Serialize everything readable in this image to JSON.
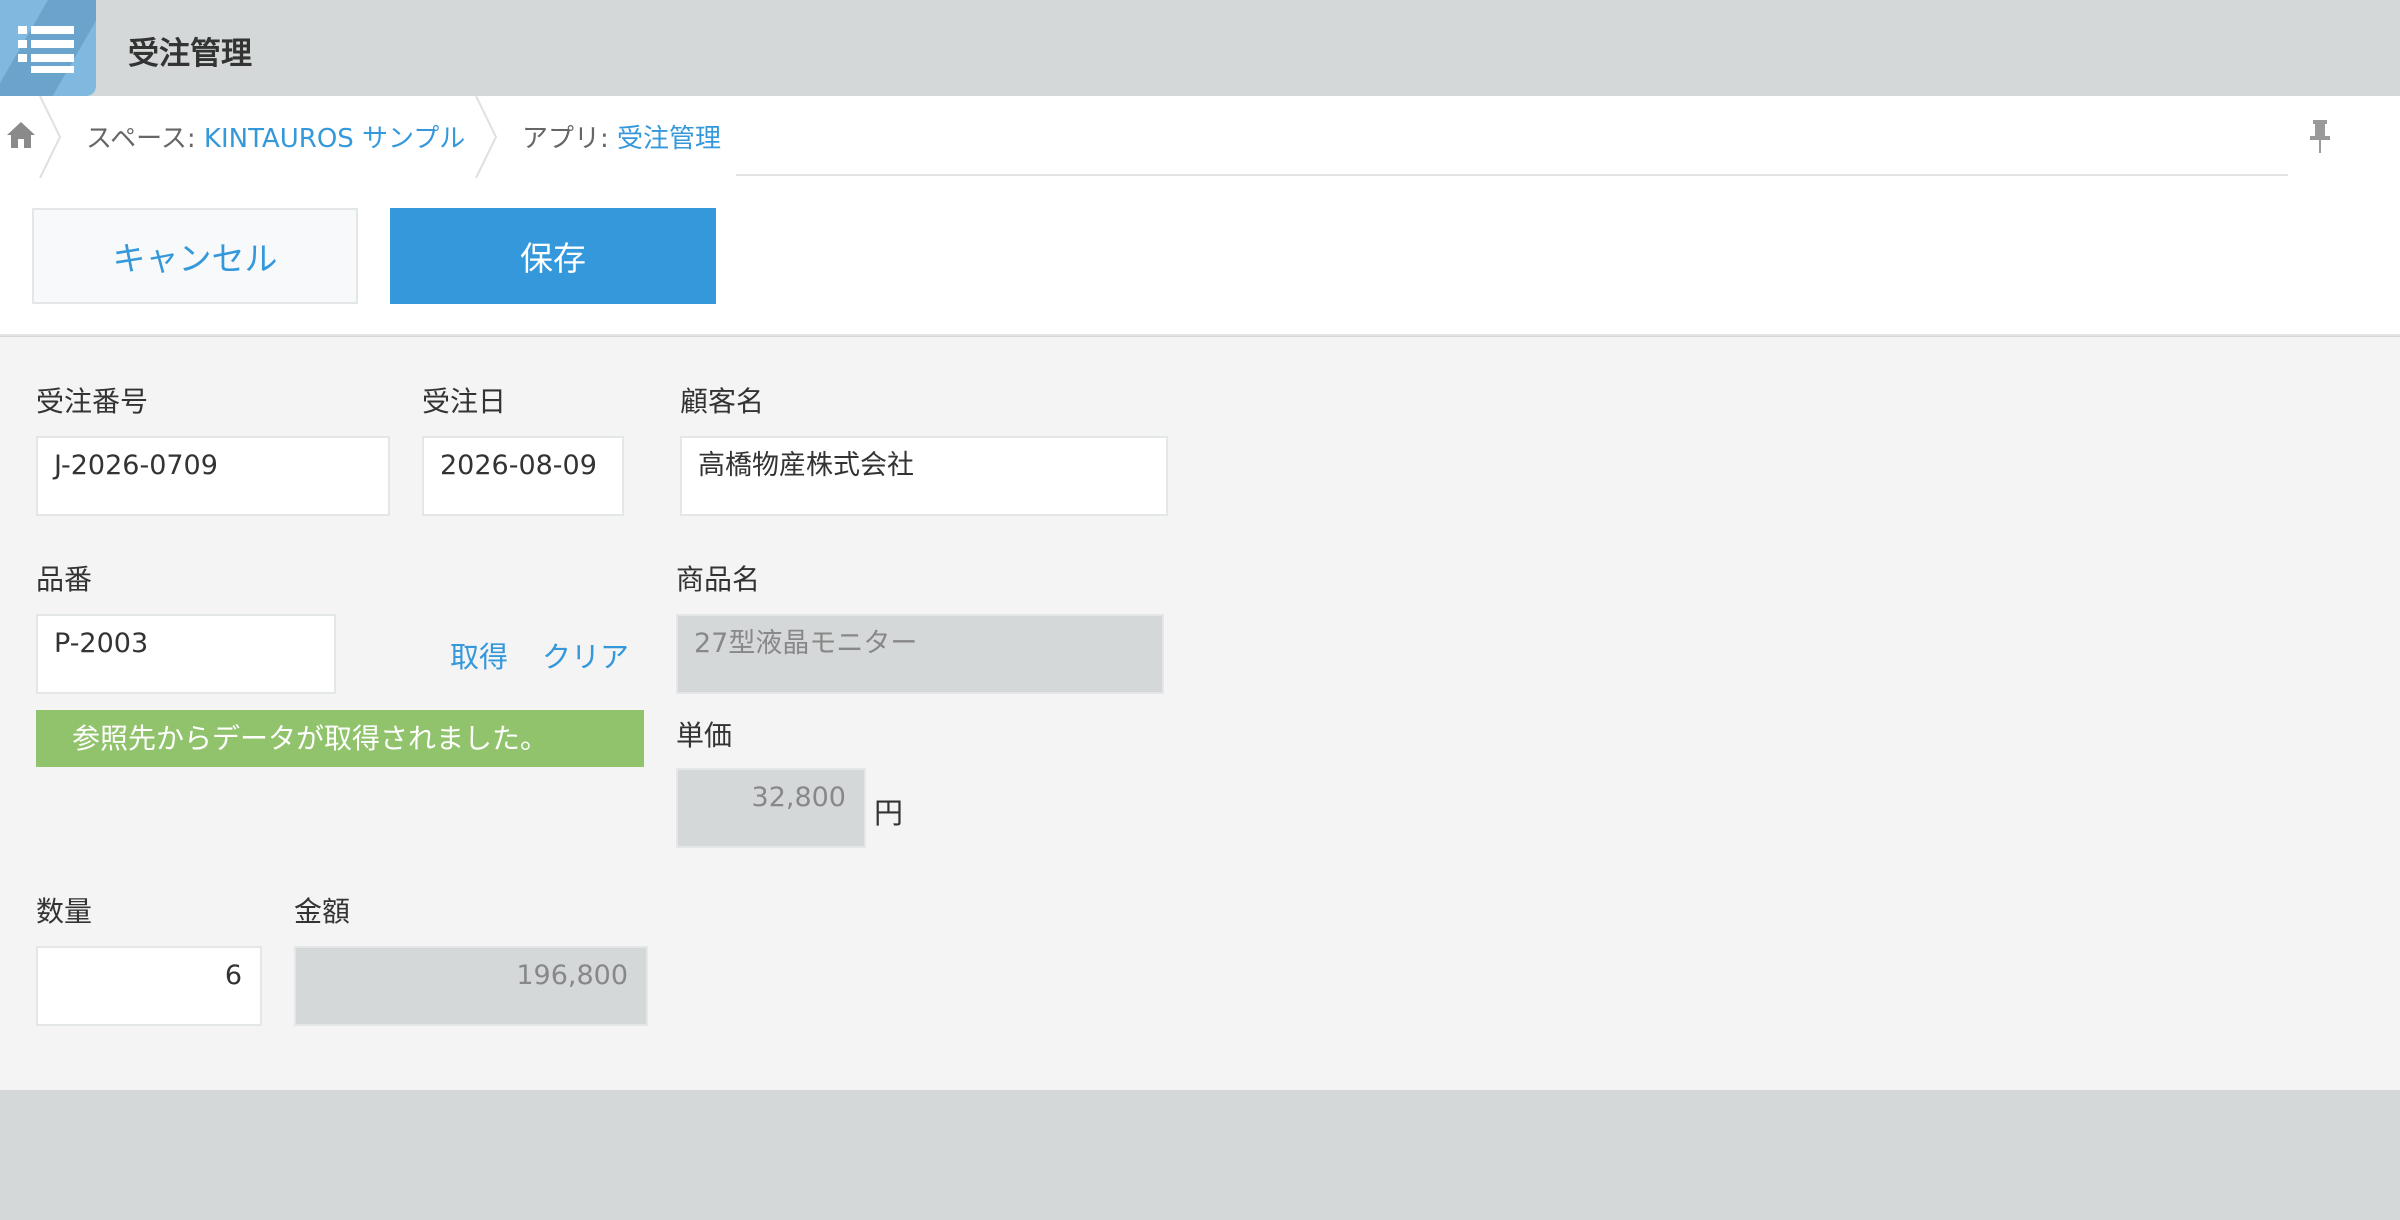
{
  "header": {
    "app_title": "受注管理"
  },
  "breadcrumb": {
    "space_prefix": "スペース: ",
    "space_name": "KINTAUROS サンプル",
    "app_prefix": "アプリ: ",
    "app_name": "受注管理"
  },
  "toolbar": {
    "cancel_label": "キャンセル",
    "save_label": "保存"
  },
  "form": {
    "order_number": {
      "label": "受注番号",
      "value": "J-2026-0709"
    },
    "order_date": {
      "label": "受注日",
      "value": "2026-08-09"
    },
    "customer_name": {
      "label": "顧客名",
      "value": "高橋物産株式会社"
    },
    "product_code": {
      "label": "品番",
      "value": "P-2003",
      "lookup_label": "取得",
      "clear_label": "クリア"
    },
    "lookup_notice": "参照先からデータが取得されました。",
    "product_name": {
      "label": "商品名",
      "value": "27型液晶モニター"
    },
    "unit_price": {
      "label": "単価",
      "value": "32,800",
      "unit": "円"
    },
    "quantity": {
      "label": "数量",
      "value": "6"
    },
    "amount": {
      "label": "金額",
      "value": "196,800"
    }
  },
  "colors": {
    "accent": "#3498db",
    "success": "#91c36c",
    "header_bg": "#d4d8d9",
    "form_bg": "#f4f4f4"
  },
  "icons": {
    "app": "list-icon",
    "home": "home-icon",
    "pin": "pin-icon"
  }
}
